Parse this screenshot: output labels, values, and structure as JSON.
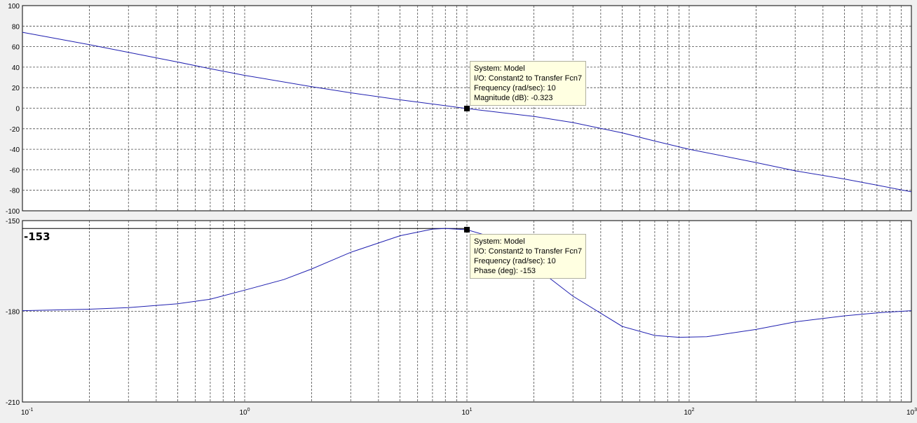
{
  "chart_data": [
    {
      "type": "line",
      "panel": "magnitude",
      "xscale": "log",
      "xlim": [
        0.1,
        1000
      ],
      "ylim": [
        -100,
        100
      ],
      "yticks": [
        -100,
        -80,
        -60,
        -40,
        -20,
        0,
        20,
        40,
        60,
        80,
        100
      ],
      "grid": true,
      "series": [
        {
          "x": [
            0.1,
            0.2,
            0.3,
            0.5,
            0.7,
            1,
            2,
            3,
            5,
            7,
            10,
            20,
            30,
            50,
            70,
            100,
            200,
            300,
            500,
            700,
            1000
          ],
          "y": [
            74,
            62,
            54.5,
            45,
            38.5,
            32,
            21,
            15,
            8.2,
            4.1,
            -0.323,
            -8,
            -14,
            -24,
            -32,
            -40,
            -53,
            -61,
            -69,
            -75,
            -81.5
          ]
        }
      ],
      "datatip": {
        "x": 10,
        "y": -0.323,
        "lines": [
          "System: Model",
          "I/O: Constant2 to Transfer Fcn7",
          "Frequency (rad/sec): 10",
          "Magnitude (dB): -0.323"
        ]
      }
    },
    {
      "type": "line",
      "panel": "phase",
      "xscale": "log",
      "xlim": [
        0.1,
        1000
      ],
      "ylim": [
        -210,
        -150
      ],
      "yticks": [
        -210,
        -180,
        -150
      ],
      "grid": true,
      "series": [
        {
          "x": [
            0.1,
            0.2,
            0.3,
            0.5,
            0.7,
            1,
            1.5,
            2,
            3,
            5,
            7,
            8,
            10,
            12,
            15,
            20,
            30,
            50,
            70,
            90,
            120,
            200,
            300,
            500,
            700,
            1000
          ],
          "y": [
            -179.8,
            -179.3,
            -178.8,
            -177.5,
            -176,
            -173,
            -169.5,
            -166,
            -160.5,
            -155,
            -152.8,
            -152.6,
            -153,
            -154.7,
            -158.5,
            -165,
            -175,
            -185,
            -188,
            -188.6,
            -188.4,
            -186,
            -183.5,
            -181.5,
            -180.5,
            -179.8
          ]
        }
      ],
      "reference_line": {
        "y": -152.6,
        "label": "-153"
      },
      "datatip": {
        "x": 10,
        "y": -153,
        "lines": [
          "System: Model",
          "I/O: Constant2 to Transfer Fcn7",
          "Frequency (rad/sec): 10",
          "Phase (deg): -153"
        ]
      }
    }
  ],
  "x_tick_labels": [
    {
      "value": 0.1,
      "base": "10",
      "exp": "-1"
    },
    {
      "value": 1,
      "base": "10",
      "exp": "0"
    },
    {
      "value": 10,
      "base": "10",
      "exp": "1"
    },
    {
      "value": 100,
      "base": "10",
      "exp": "2"
    },
    {
      "value": 1000,
      "base": "10",
      "exp": "3"
    }
  ],
  "colors": {
    "curve": "#2020b0",
    "background": "#f0f0f0",
    "axes": "#ffffff",
    "datatip": "#ffffe1",
    "grid": "#4a4a4a"
  }
}
